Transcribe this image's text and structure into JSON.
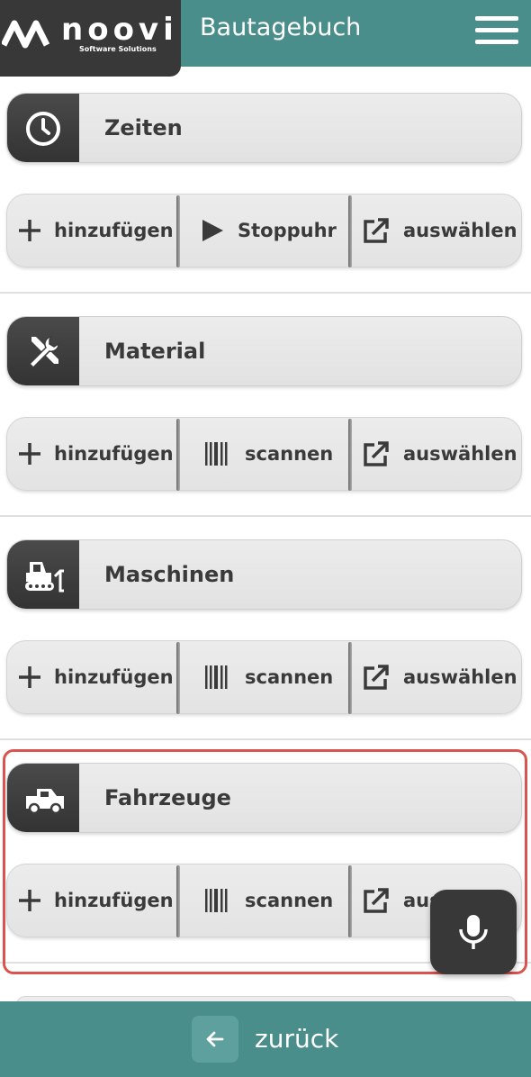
{
  "header": {
    "logo_text": "noovi",
    "logo_subtext": "Software Solutions",
    "title": "Bautagebuch",
    "menu_icon": "hamburger-menu-icon"
  },
  "colors": {
    "header_bg": "#4a8e8b",
    "logo_bg": "#383838",
    "highlight_border": "#d9534f",
    "text_dark": "#3a3a3a"
  },
  "sections": [
    {
      "title": "Zeiten",
      "icon": "clock-icon",
      "actions": [
        {
          "label": "hinzufügen",
          "icon": "plus-icon"
        },
        {
          "label": "Stoppuhr",
          "icon": "play-icon"
        },
        {
          "label": "auswählen",
          "icon": "external-link-icon"
        }
      ]
    },
    {
      "title": "Material",
      "icon": "tools-icon",
      "actions": [
        {
          "label": "hinzufügen",
          "icon": "plus-icon"
        },
        {
          "label": "scannen",
          "icon": "barcode-icon"
        },
        {
          "label": "auswählen",
          "icon": "external-link-icon"
        }
      ]
    },
    {
      "title": "Maschinen",
      "icon": "bulldozer-icon",
      "actions": [
        {
          "label": "hinzufügen",
          "icon": "plus-icon"
        },
        {
          "label": "scannen",
          "icon": "barcode-icon"
        },
        {
          "label": "auswählen",
          "icon": "external-link-icon"
        }
      ]
    },
    {
      "title": "Fahrzeuge",
      "icon": "truck-icon",
      "actions": [
        {
          "label": "hinzufügen",
          "icon": "plus-icon"
        },
        {
          "label": "scannen",
          "icon": "barcode-icon"
        },
        {
          "label": "aus",
          "icon": "external-link-icon"
        }
      ]
    }
  ],
  "fab": {
    "icon": "microphone-icon"
  },
  "footer": {
    "back_label": "zurück",
    "back_icon": "arrow-left-icon"
  }
}
